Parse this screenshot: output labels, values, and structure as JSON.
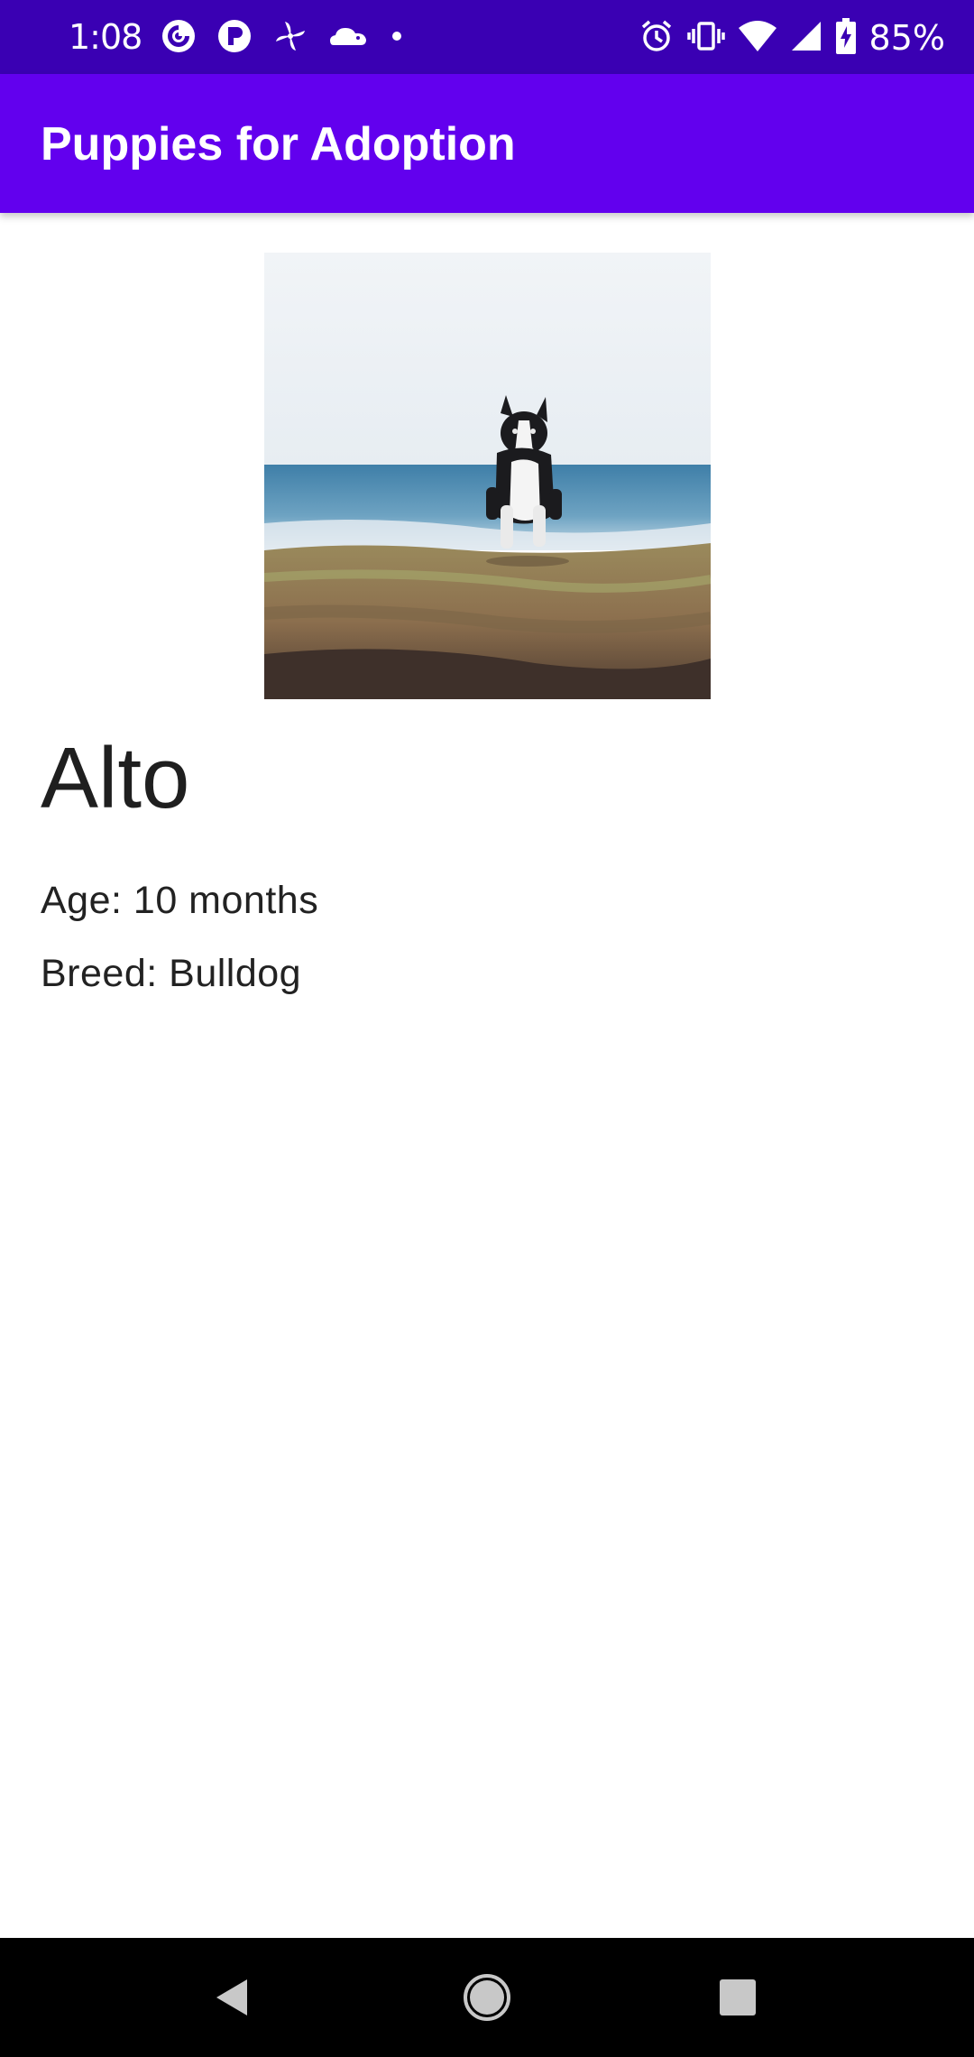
{
  "status_bar": {
    "time": "1:08",
    "battery_percent": "85%",
    "left_icons": [
      "pocket-casts-icon",
      "pandora-icon",
      "pinwheel-icon",
      "cloud-hedgehog-icon",
      "notification-dot-icon"
    ],
    "right_icons": [
      "alarm-icon",
      "vibrate-icon",
      "wifi-icon",
      "signal-icon",
      "battery-charging-icon"
    ]
  },
  "app_bar": {
    "title": "Puppies for Adoption"
  },
  "puppy": {
    "photo_icon": "dog-photo",
    "name": "Alto",
    "age": "Age: 10 months",
    "breed": "Breed: Bulldog"
  },
  "nav_bar": {
    "buttons": [
      "back-icon",
      "home-icon",
      "recents-icon"
    ]
  },
  "colors": {
    "status_bar": "#3a00b3",
    "app_bar": "#6200ee",
    "background": "#ffffff",
    "nav_bar": "#000000"
  }
}
